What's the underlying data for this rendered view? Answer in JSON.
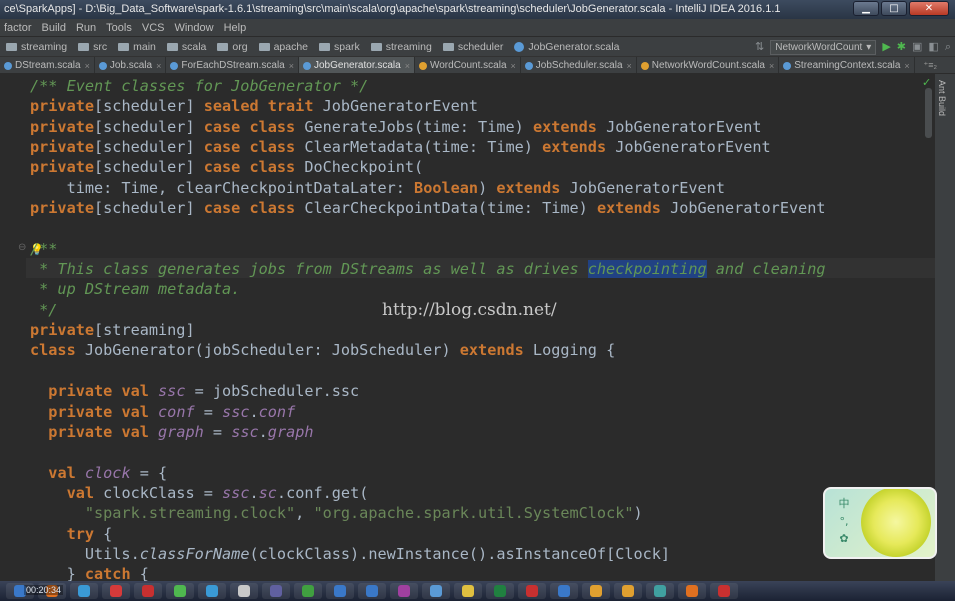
{
  "window": {
    "title": "ce\\SparkApps] - D:\\Big_Data_Software\\spark-1.6.1\\streaming\\src\\main\\scala\\org\\apache\\spark\\streaming\\scheduler\\JobGenerator.scala - IntelliJ IDEA 2016.1.1",
    "min": "▁",
    "max": "□",
    "close": "✕"
  },
  "menu": [
    "factor",
    "Build",
    "Run",
    "Tools",
    "VCS",
    "Window",
    "Help"
  ],
  "breadcrumb": [
    "streaming",
    "src",
    "main",
    "scala",
    "org",
    "apache",
    "spark",
    "streaming",
    "scheduler",
    "JobGenerator.scala"
  ],
  "run_config": "NetworkWordCount",
  "tabs": [
    {
      "label": "DStream.scala",
      "icon": "scala-class",
      "active": false
    },
    {
      "label": "Job.scala",
      "icon": "scala-class",
      "active": false
    },
    {
      "label": "ForEachDStream.scala",
      "icon": "scala-class",
      "active": false
    },
    {
      "label": "JobGenerator.scala",
      "icon": "scala-class",
      "active": true
    },
    {
      "label": "WordCount.scala",
      "icon": "scala-object",
      "active": false
    },
    {
      "label": "JobScheduler.scala",
      "icon": "scala-class",
      "active": false
    },
    {
      "label": "NetworkWordCount.scala",
      "icon": "scala-object",
      "active": false
    },
    {
      "label": "StreamingContext.scala",
      "icon": "scala-class",
      "active": false
    }
  ],
  "tab_more": "⁺≡₂",
  "side_panel": "Ant Build",
  "watermark": "http://blog.csdn.net/",
  "clock": "00:20:34",
  "code": [
    [
      [
        "cm",
        "/** Event classes for JobGenerator */"
      ]
    ],
    [
      [
        "kw",
        "private"
      ],
      [
        "ty",
        "[scheduler] "
      ],
      [
        "kw",
        "sealed trait"
      ],
      [
        "ty",
        " JobGeneratorEvent"
      ]
    ],
    [
      [
        "kw",
        "private"
      ],
      [
        "ty",
        "[scheduler] "
      ],
      [
        "kw",
        "case class"
      ],
      [
        "ty",
        " GenerateJobs(time: Time) "
      ],
      [
        "kw",
        "extends"
      ],
      [
        "ty",
        " JobGeneratorEvent"
      ]
    ],
    [
      [
        "kw",
        "private"
      ],
      [
        "ty",
        "[scheduler] "
      ],
      [
        "kw",
        "case class"
      ],
      [
        "ty",
        " ClearMetadata(time: Time) "
      ],
      [
        "kw",
        "extends"
      ],
      [
        "ty",
        " JobGeneratorEvent"
      ]
    ],
    [
      [
        "kw",
        "private"
      ],
      [
        "ty",
        "[scheduler] "
      ],
      [
        "kw",
        "case class"
      ],
      [
        "ty",
        " DoCheckpoint("
      ]
    ],
    [
      [
        "ty",
        "    time: Time, clearCheckpointDataLater: "
      ],
      [
        "kw",
        "Boolean"
      ],
      [
        "ty",
        ") "
      ],
      [
        "kw",
        "extends"
      ],
      [
        "ty",
        " JobGeneratorEvent"
      ]
    ],
    [
      [
        "kw",
        "private"
      ],
      [
        "ty",
        "[scheduler] "
      ],
      [
        "kw",
        "case class"
      ],
      [
        "ty",
        " ClearCheckpointData(time: Time) "
      ],
      [
        "kw",
        "extends"
      ],
      [
        "ty",
        " JobGeneratorEvent"
      ]
    ],
    [],
    [
      [
        "cm",
        "/**"
      ]
    ],
    [
      [
        "cm",
        " * This class generates jobs from DStreams as well as drives "
      ],
      [
        "sel",
        "checkpointing"
      ],
      [
        "cm",
        " and cleaning"
      ]
    ],
    [
      [
        "cm",
        " * up DStream metadata."
      ]
    ],
    [
      [
        "cm",
        " */"
      ]
    ],
    [
      [
        "kw",
        "private"
      ],
      [
        "ty",
        "[streaming]"
      ]
    ],
    [
      [
        "kw",
        "class"
      ],
      [
        "ty",
        " JobGenerator(jobScheduler: JobScheduler) "
      ],
      [
        "kw",
        "extends"
      ],
      [
        "ty",
        " Logging {"
      ]
    ],
    [],
    [
      [
        "ty",
        "  "
      ],
      [
        "kw",
        "private val"
      ],
      [
        "fld",
        " ssc"
      ],
      [
        "ty",
        " = jobScheduler.ssc"
      ]
    ],
    [
      [
        "ty",
        "  "
      ],
      [
        "kw",
        "private val"
      ],
      [
        "fld",
        " conf"
      ],
      [
        "ty",
        " = "
      ],
      [
        "fld",
        "ssc"
      ],
      [
        "ty",
        "."
      ],
      [
        "fld",
        "conf"
      ]
    ],
    [
      [
        "ty",
        "  "
      ],
      [
        "kw",
        "private val"
      ],
      [
        "fld",
        " graph"
      ],
      [
        "ty",
        " = "
      ],
      [
        "fld",
        "ssc"
      ],
      [
        "ty",
        "."
      ],
      [
        "fld",
        "graph"
      ]
    ],
    [],
    [
      [
        "ty",
        "  "
      ],
      [
        "kw",
        "val"
      ],
      [
        "fld",
        " clock"
      ],
      [
        "ty",
        " = {"
      ]
    ],
    [
      [
        "ty",
        "    "
      ],
      [
        "kw",
        "val"
      ],
      [
        "ty",
        " clockClass = "
      ],
      [
        "fld",
        "ssc"
      ],
      [
        "ty",
        "."
      ],
      [
        "fld",
        "sc"
      ],
      [
        "ty",
        ".conf.get("
      ]
    ],
    [
      [
        "str",
        "      \"spark.streaming.clock\""
      ],
      [
        "ty",
        ", "
      ],
      [
        "str",
        "\"org.apache.spark.util.SystemClock\""
      ],
      [
        "ty",
        ")"
      ]
    ],
    [
      [
        "ty",
        "    "
      ],
      [
        "kw",
        "try"
      ],
      [
        "ty",
        " {"
      ]
    ],
    [
      [
        "ty",
        "      Utils."
      ],
      [
        "it",
        "classForName"
      ],
      [
        "ty",
        "(clockClass).newInstance().asInstanceOf[Clock]"
      ]
    ],
    [
      [
        "ty",
        "    } "
      ],
      [
        "kw",
        "catch"
      ],
      [
        "ty",
        " {"
      ]
    ]
  ]
}
